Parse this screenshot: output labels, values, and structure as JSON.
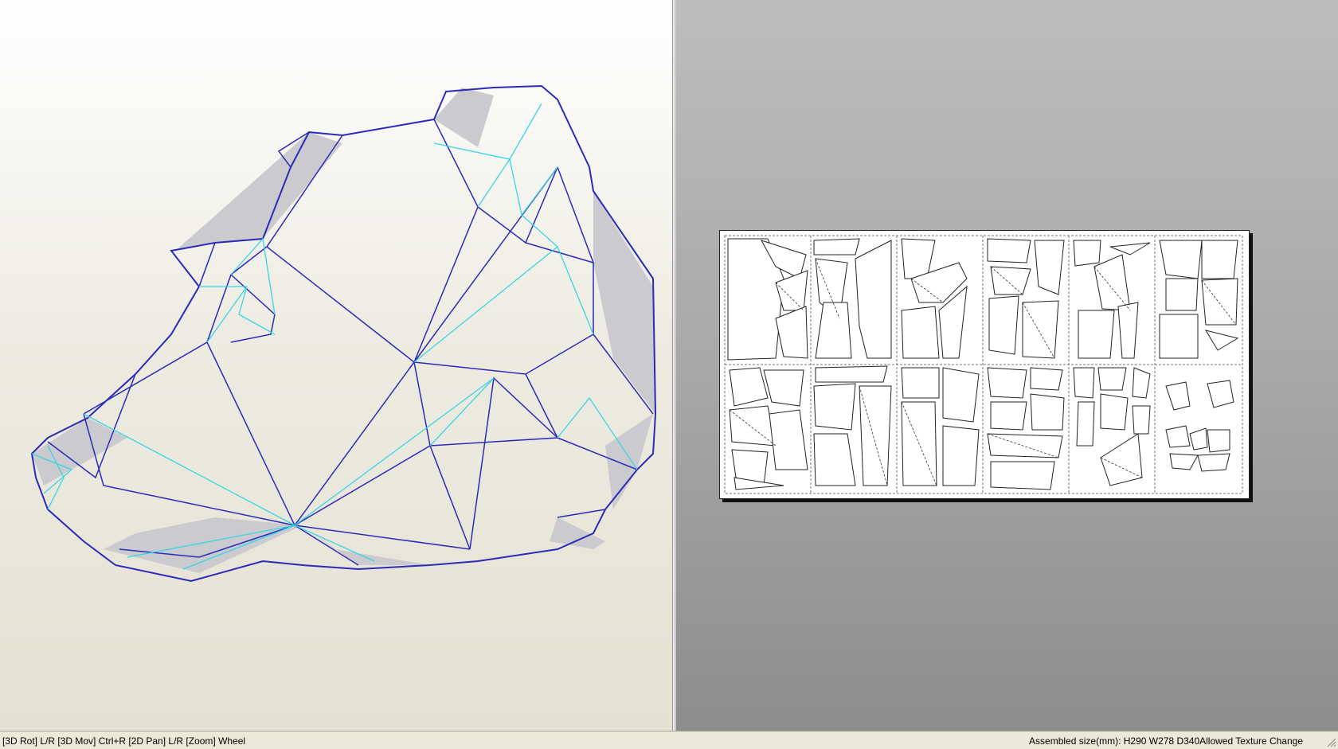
{
  "statusbar": {
    "hints": "[3D Rot] L/R [3D Mov] Ctrl+R [2D Pan] L/R [Zoom] Wheel",
    "assembled": "Assembled size(mm): H290 W278 D340Allowed Texture Change"
  },
  "colors": {
    "mountain_fold": "#2c2ab8",
    "valley_fold": "#37d6e6",
    "shade": "#c9c9ce",
    "sheet_outline": "#222222"
  },
  "icons": [
    "bear-head-3d-model-icon",
    "unfolded-parts-pattern-icon",
    "resize-grip-icon"
  ]
}
